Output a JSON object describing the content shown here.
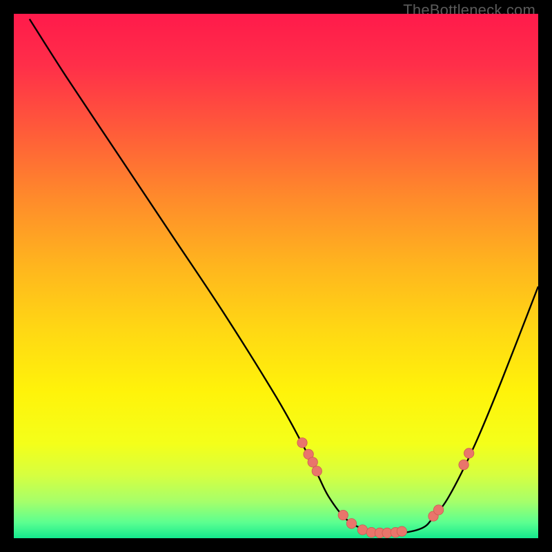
{
  "watermark": "TheBottleneck.com",
  "colors": {
    "bg": "#000000",
    "gradient_stops": [
      {
        "offset": 0.0,
        "color": "#ff1a4b"
      },
      {
        "offset": 0.1,
        "color": "#ff2f49"
      },
      {
        "offset": 0.22,
        "color": "#ff5a3a"
      },
      {
        "offset": 0.35,
        "color": "#ff8a2b"
      },
      {
        "offset": 0.48,
        "color": "#ffb51e"
      },
      {
        "offset": 0.6,
        "color": "#ffd714"
      },
      {
        "offset": 0.72,
        "color": "#fff30a"
      },
      {
        "offset": 0.82,
        "color": "#f4ff1a"
      },
      {
        "offset": 0.88,
        "color": "#d6ff40"
      },
      {
        "offset": 0.93,
        "color": "#a6ff6a"
      },
      {
        "offset": 0.97,
        "color": "#5cff90"
      },
      {
        "offset": 1.0,
        "color": "#14e98e"
      }
    ],
    "curve": "#000000",
    "dot_fill": "#e9756b",
    "dot_stroke": "#cc5a52"
  },
  "chart_data": {
    "type": "line",
    "title": "",
    "xlabel": "",
    "ylabel": "",
    "xlim": [
      0,
      100
    ],
    "ylim": [
      0,
      100
    ],
    "series": [
      {
        "name": "bottleneck-curve",
        "x": [
          3,
          10,
          20,
          30,
          40,
          50,
          55,
          58,
          60,
          63,
          66,
          70,
          74,
          78,
          80,
          83,
          88,
          93,
          100
        ],
        "y": [
          99,
          88,
          73,
          58,
          43,
          27,
          18,
          12,
          8,
          4,
          2,
          1,
          1,
          2,
          4,
          8,
          18,
          30,
          48
        ]
      }
    ],
    "markers": {
      "name": "highlight-dots",
      "x": [
        55.0,
        56.2,
        57.0,
        57.8,
        62.8,
        64.4,
        66.5,
        68.2,
        69.8,
        71.2,
        72.8,
        74.0,
        80.0,
        81.0,
        85.8,
        86.8
      ],
      "y": [
        18.2,
        16.0,
        14.5,
        12.8,
        4.4,
        2.8,
        1.6,
        1.1,
        1.0,
        1.0,
        1.1,
        1.3,
        4.2,
        5.4,
        14.0,
        16.2
      ]
    }
  }
}
